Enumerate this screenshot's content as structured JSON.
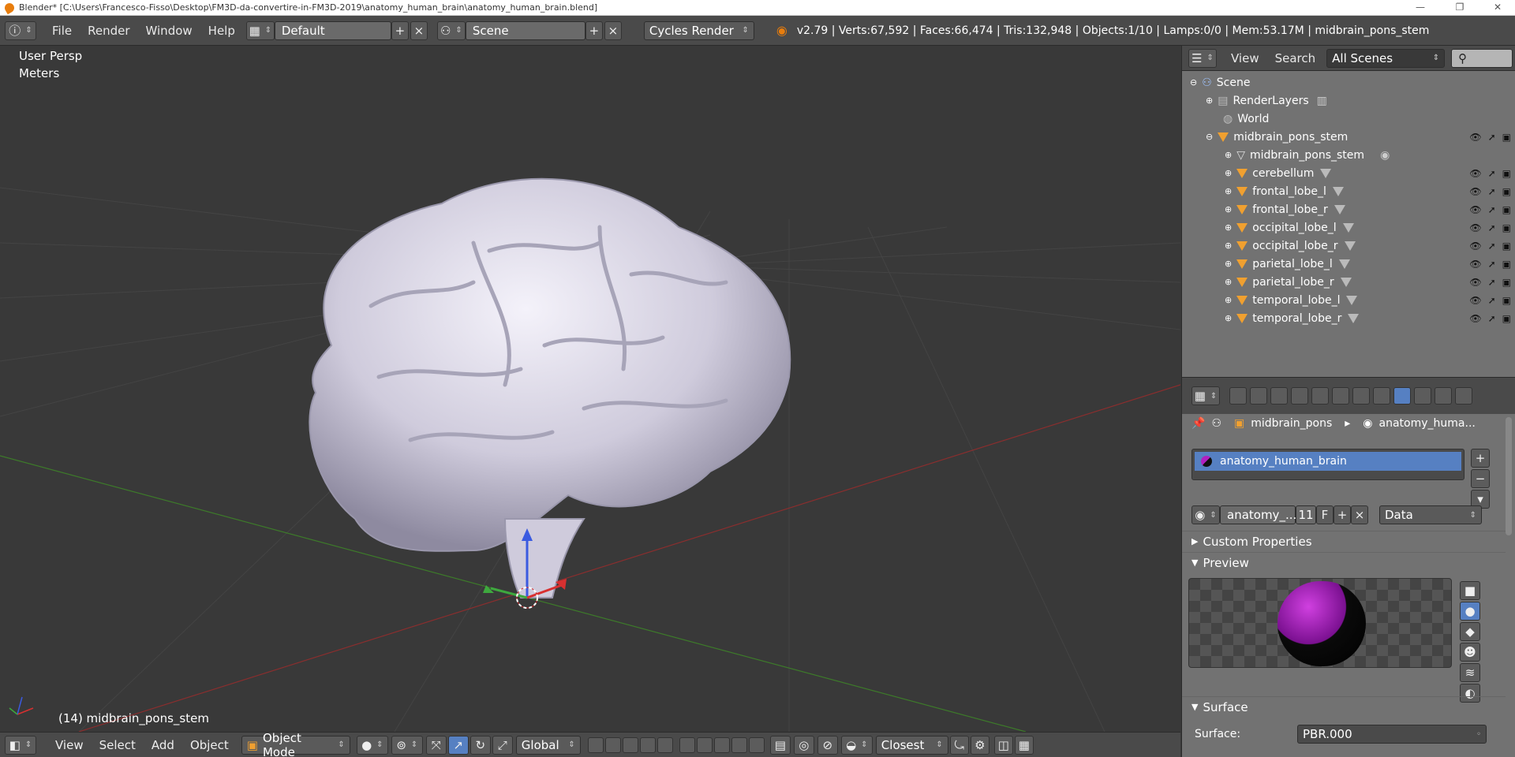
{
  "window": {
    "title": "Blender* [C:\\Users\\Francesco-Fisso\\Desktop\\FM3D-da-convertire-in-FM3D-2019\\anatomy_human_brain\\anatomy_human_brain.blend]",
    "min": "—",
    "max": "❐",
    "close": "✕"
  },
  "topbar": {
    "menus": [
      "File",
      "Render",
      "Window",
      "Help"
    ],
    "layout": "Default",
    "scene": "Scene",
    "engine": "Cycles Render",
    "stats": "v2.79 | Verts:67,592 | Faces:66,474 | Tris:132,948 | Objects:1/10 | Lamps:0/0 | Mem:53.17M | midbrain_pons_stem"
  },
  "viewport": {
    "view_label": "User Persp",
    "units_label": "Meters",
    "object_label": "(14) midbrain_pons_stem"
  },
  "outliner": {
    "menus": [
      "View",
      "Search"
    ],
    "filter": "All Scenes",
    "items": [
      {
        "label": "Scene"
      },
      {
        "label": "RenderLayers"
      },
      {
        "label": "World"
      },
      {
        "label": "midbrain_pons_stem"
      },
      {
        "label": "midbrain_pons_stem"
      },
      {
        "label": "cerebellum"
      },
      {
        "label": "frontal_lobe_l"
      },
      {
        "label": "frontal_lobe_r"
      },
      {
        "label": "occipital_lobe_l"
      },
      {
        "label": "occipital_lobe_r"
      },
      {
        "label": "parietal_lobe_l"
      },
      {
        "label": "parietal_lobe_r"
      },
      {
        "label": "temporal_lobe_l"
      },
      {
        "label": "temporal_lobe_r"
      }
    ]
  },
  "properties": {
    "breadcrumb_object": "midbrain_pons",
    "breadcrumb_material": "anatomy_huma...",
    "material_slot": "anatomy_human_brain",
    "material_name": "anatomy_...",
    "users": "11",
    "fake": "F",
    "link": "Data",
    "panels": {
      "custom_properties": "Custom Properties",
      "preview": "Preview",
      "surface": "Surface"
    },
    "surface_label": "Surface:",
    "surface_value": "PBR.000"
  },
  "bottombar": {
    "menus": [
      "View",
      "Select",
      "Add",
      "Object"
    ],
    "mode": "Object Mode",
    "orientation": "Global",
    "snap": "Closest"
  },
  "colors": {
    "accent": "#5680c2",
    "orange": "#f0a030",
    "brain": "#d9d6e4"
  }
}
